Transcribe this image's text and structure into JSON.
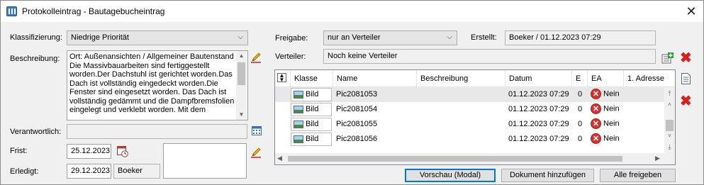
{
  "window": {
    "title": "Protokolleintrag - Bautagebucheintrag",
    "close_glyph": "✕"
  },
  "left": {
    "klassifizierung_label": "Klassifizierung:",
    "klassifizierung_value": "Niedrige Priorität",
    "beschreibung_label": "Beschreibung:",
    "beschreibung_text": "Ort: Außenansichten / Allgemeiner Bautenstand Die Massivbauarbeiten sind fertiggestellt worden.Der Dachstuhl ist gerichtet worden.Das Dach ist vollständig eingedeckt worden.Die Fenster sind eingesetzt worden. Das Dach ist vollständig gedämmt und die Dampfbremsfolien eingelegt und verklebt worden. Mit dem",
    "verantwortlich_label": "Verantwortlich:",
    "verantwortlich_value": "",
    "frist_label": "Frist:",
    "frist_value": "25.12.2023",
    "erledigt_label": "Erledigt:",
    "erledigt_value": "29.12.2023",
    "erledigt_by": "Boeker"
  },
  "right": {
    "freigabe_label": "Freigabe:",
    "freigabe_value": "nur an Verteiler",
    "erstellt_label": "Erstellt:",
    "erstellt_value": "Boeker / 01.12.2023 07:29",
    "verteiler_label": "Verteiler:",
    "verteiler_value": "Noch keine Verteiler"
  },
  "grid": {
    "headers": [
      "Klasse",
      "Name",
      "Beschreibung",
      "Datum",
      "E",
      "EA",
      "1. Adresse"
    ],
    "rows": [
      {
        "klasse": "Bild",
        "name": "Pic2081053",
        "beschreibung": "",
        "datum": "01.12.2023 07:29",
        "e": "0",
        "ea": "Nein",
        "selected": true
      },
      {
        "klasse": "Bild",
        "name": "Pic2081054",
        "beschreibung": "",
        "datum": "01.12.2023 07:29",
        "e": "0",
        "ea": "Nein",
        "selected": false
      },
      {
        "klasse": "Bild",
        "name": "Pic2081055",
        "beschreibung": "",
        "datum": "01.12.2023 07:29",
        "e": "0",
        "ea": "Nein",
        "selected": false
      },
      {
        "klasse": "Bild",
        "name": "Pic2081056",
        "beschreibung": "",
        "datum": "01.12.2023 07:29",
        "e": "0",
        "ea": "Nein",
        "selected": false
      }
    ]
  },
  "buttons": {
    "vorschau": "Vorschau (Modal)",
    "dokument": "Dokument hinzufügen",
    "freigeben": "Alle freigeben"
  },
  "colors": {
    "accent": "#0078d7",
    "delete": "#d61f1f",
    "no_icon": "#d8312e"
  },
  "icons": [
    "app-icon",
    "close-icon",
    "edit-pencil-icon",
    "calendar-icon",
    "calendar-clock-icon",
    "add-distributor-icon",
    "delete-icon",
    "document-icon",
    "sort-icon",
    "image-icon",
    "no-icon"
  ]
}
